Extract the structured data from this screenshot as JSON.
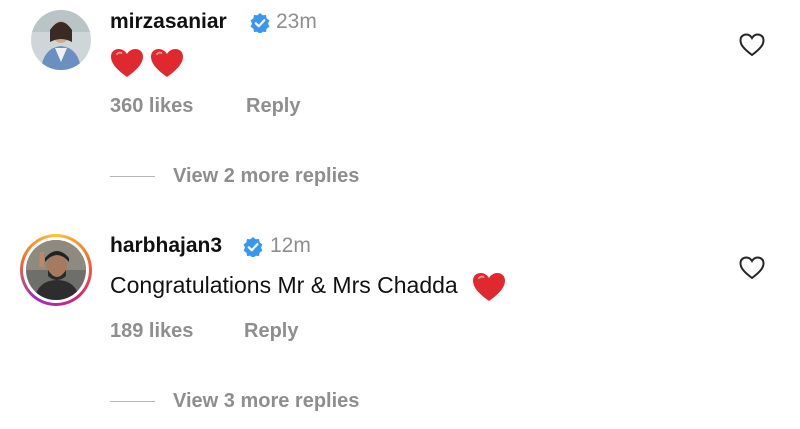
{
  "comments": [
    {
      "username": "mirzasaniar",
      "verified": true,
      "time": "23m",
      "text": "",
      "emoji": [
        "red-heart",
        "red-heart"
      ],
      "likes": "360 likes",
      "reply_label": "Reply",
      "view_replies": "View 2 more replies"
    },
    {
      "username": "harbhajan3",
      "verified": true,
      "time": "12m",
      "text": "Congratulations Mr & Mrs Chadda",
      "emoji": [
        "red-heart"
      ],
      "likes": "189 likes",
      "reply_label": "Reply",
      "view_replies": "View 3 more replies"
    }
  ],
  "colors": {
    "verified_blue": "#3897f0",
    "meta_gray": "#8e8e8e",
    "heart_red": "#e0292e",
    "story_ring": [
      "#fdc43a",
      "#f56b2a",
      "#d3217b",
      "#9b2ebf"
    ]
  }
}
